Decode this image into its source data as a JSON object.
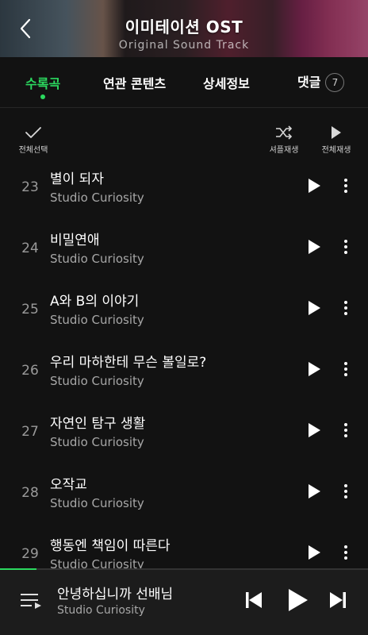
{
  "header": {
    "title": "이미테이션 OST",
    "subtitle": "Original Sound Track"
  },
  "tabs": [
    {
      "label": "수록곡",
      "active": true
    },
    {
      "label": "연관 콘텐츠",
      "active": false
    },
    {
      "label": "상세정보",
      "active": false
    },
    {
      "label": "댓글",
      "active": false,
      "badge": "7"
    }
  ],
  "actions": {
    "select_all": "전체선택",
    "shuffle_play": "셔플재생",
    "play_all": "전체재생"
  },
  "tracks": [
    {
      "number": "23",
      "title": "별이 되자",
      "artist": "Studio Curiosity"
    },
    {
      "number": "24",
      "title": "비밀연애",
      "artist": "Studio Curiosity"
    },
    {
      "number": "25",
      "title": "A와 B의 이야기",
      "artist": "Studio Curiosity"
    },
    {
      "number": "26",
      "title": "우리 마하한테 무슨 볼일로?",
      "artist": "Studio Curiosity"
    },
    {
      "number": "27",
      "title": "자연인 탐구 생활",
      "artist": "Studio Curiosity"
    },
    {
      "number": "28",
      "title": "오작교",
      "artist": "Studio Curiosity"
    },
    {
      "number": "29",
      "title": "행동엔 책임이 따른다",
      "artist": "Studio Curiosity"
    }
  ],
  "player": {
    "title": "안녕하십니까 선배님",
    "artist": "Studio Curiosity",
    "progress_fraction": 0.1
  },
  "colors": {
    "accent": "#2bd85f",
    "background": "#121212",
    "player_background": "#1c1c1c"
  }
}
